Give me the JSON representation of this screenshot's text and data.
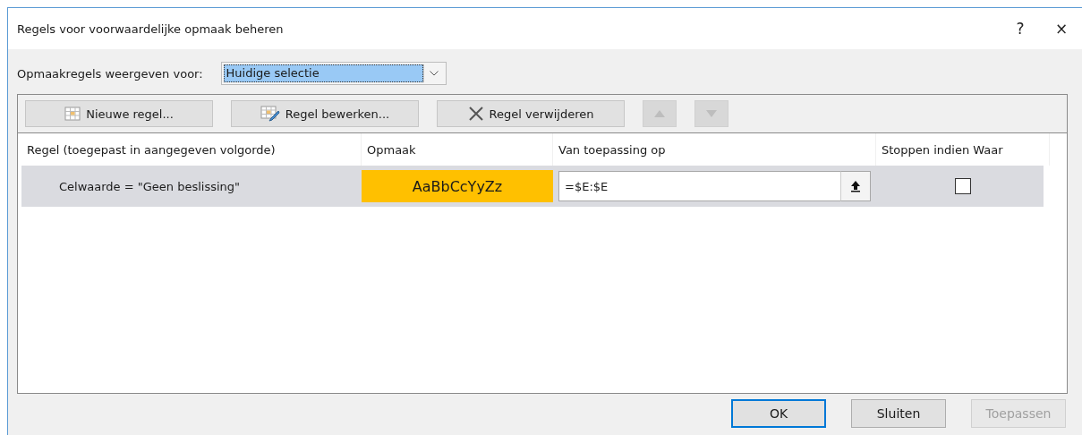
{
  "window": {
    "title": "Regels voor voorwaardelijke opmaak beheren",
    "help": "?",
    "close": "×"
  },
  "filter": {
    "label": "Opmaakregels weergeven voor:",
    "value": "Huidige selectie"
  },
  "toolbar": [
    {
      "kind": "new",
      "label": "Nieuwe regel...",
      "disabled": false
    },
    {
      "kind": "edit",
      "label": "Regel bewerken...",
      "disabled": false
    },
    {
      "kind": "delete",
      "label": "Regel verwijderen",
      "disabled": false
    },
    {
      "kind": "up",
      "disabled": true
    },
    {
      "kind": "down",
      "disabled": true
    }
  ],
  "table": {
    "columns": [
      "Regel (toegepast in aangegeven volgorde)",
      "Opmaak",
      "Van toepassing op",
      "Stoppen indien Waar"
    ],
    "rows": [
      {
        "rule": "Celwaarde = \"Geen beslissing\"",
        "preview": "AaBbCcYyZz",
        "color": "#ffc000",
        "applies_to": "=$E:$E",
        "stop_if_true": false,
        "selected": true
      }
    ]
  },
  "buttons": [
    {
      "label": "OK",
      "default": true,
      "disabled": false
    },
    {
      "label": "Sluiten",
      "default": false,
      "disabled": false
    },
    {
      "label": "Toepassen",
      "default": false,
      "disabled": true
    }
  ]
}
